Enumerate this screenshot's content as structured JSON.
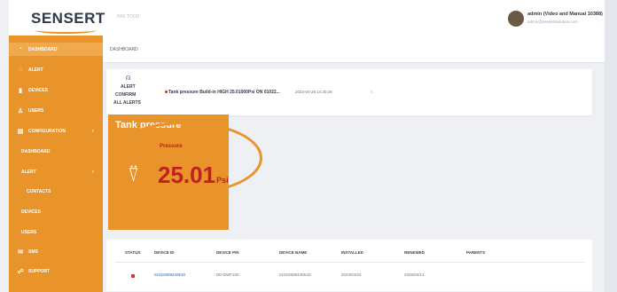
{
  "header": {
    "logo": "SENSERT",
    "top_crumb": "PAS TOOD",
    "user_name": "admin (Video and Manual 10388)",
    "user_email": "admin@sensertsolution.com"
  },
  "sidebar": {
    "items": [
      {
        "label": "DASHBOARD",
        "icon": "dashboard-icon",
        "glyph": "◔"
      },
      {
        "label": "ALERT",
        "icon": "alert-icon",
        "glyph": "◌"
      },
      {
        "label": "DEVICES",
        "icon": "devices-icon",
        "glyph": "▮"
      },
      {
        "label": "USERS",
        "icon": "users-icon",
        "glyph": "♙"
      },
      {
        "label": "CONFIGURATION",
        "icon": "config-icon",
        "glyph": "▤"
      },
      {
        "label": "DASHBOARD"
      },
      {
        "label": "ALERT"
      },
      {
        "label": "CONTACTS"
      },
      {
        "label": "DEVICES"
      },
      {
        "label": "USERS"
      },
      {
        "label": "SMS",
        "icon": "sms-icon",
        "glyph": "✉"
      },
      {
        "label": "SUPPORT",
        "icon": "support-icon",
        "glyph": "☍"
      }
    ]
  },
  "breadcrumb": "DASHBOARD",
  "alert_panel": {
    "lines": [
      "ALERT",
      "CONFIRM",
      "ALL ALERTS"
    ],
    "message": "Tank pressure Build-in HIGH 25.01000Psi ON 01022...",
    "time": "2023-04-28 14:30:26",
    "close": "x"
  },
  "tank": {
    "title": "Tank pressure",
    "label": "Pressure",
    "value": "25.01",
    "unit": "Psi"
  },
  "table": {
    "headers": [
      "STATUS",
      "DEVICE ID",
      "DEVICE P/N",
      "DEVICE NAME",
      "INSTALLED",
      "RENEWED",
      "PARENTS"
    ],
    "row": {
      "device_id": "01022609440510",
      "device_pn": "DD-BWF100",
      "device_name": "0102260944051D",
      "installed": "2023/04/23",
      "renewed": "2026/04/14"
    }
  },
  "colors": {
    "accent": "#e8942a",
    "alarm": "#c02020",
    "link": "#2a5da8"
  }
}
